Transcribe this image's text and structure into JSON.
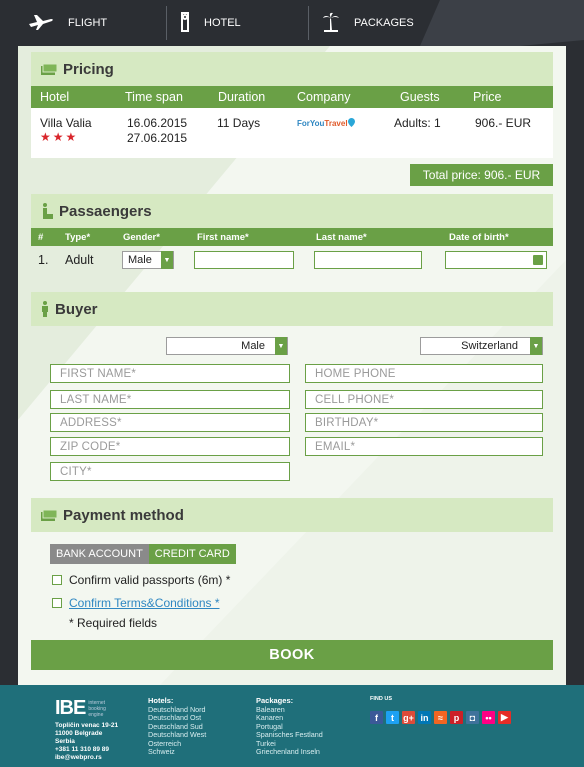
{
  "nav": {
    "flight": "FLIGHT",
    "hotel": "HOTEL",
    "packages": "PACKAGES"
  },
  "pricing": {
    "title": "Pricing",
    "headers": [
      "Hotel",
      "Time span",
      "Duration",
      "Company",
      "Guests",
      "Price"
    ],
    "row": {
      "hotel": "Villa Valia",
      "stars": "★★★",
      "date_from": "16.06.2015",
      "date_to": "27.06.2015",
      "duration": "11 Days",
      "company_a": "ForYou",
      "company_b": "Travel",
      "guests": "Adults: 1",
      "price": "906.- EUR"
    },
    "total": "Total price: 906.- EUR"
  },
  "passengers": {
    "title": "Passaengers",
    "headers": [
      "#",
      "Type*",
      "Gender*",
      "First name*",
      "Last name*",
      "Date of birth*"
    ],
    "row": {
      "num": "1.",
      "type": "Adult",
      "gender": "Male"
    }
  },
  "buyer": {
    "title": "Buyer",
    "gender": "Male",
    "country": "Switzerland",
    "fields_left": [
      "FIRST NAME*",
      "LAST NAME*",
      "ADDRESS*",
      "ZIP CODE*",
      "CITY*"
    ],
    "fields_right": [
      "HOME PHONE",
      "CELL PHONE*",
      "BIRTHDAY*",
      "EMAIL*"
    ]
  },
  "payment": {
    "title": "Payment method",
    "tab_bank": "BANK ACCOUNT",
    "tab_card": "CREDIT CARD",
    "confirm_passports": "Confirm valid passports (6m) *",
    "confirm_terms": "Confirm Terms&Conditions *",
    "required": "* Required fields",
    "book": "BOOK"
  },
  "footer": {
    "logo": "IBE",
    "logo_sub": [
      "internet",
      "booking",
      "engine"
    ],
    "address": [
      "Topličin venac 19-21",
      "11000 Belgrade",
      "Serbia",
      "+381 11 310 89 89",
      "ibe@webpro.rs"
    ],
    "hotels_title": "Hotels:",
    "hotels": [
      "Deutschland Nord",
      "Deutschland Ost",
      "Deutschland Sud",
      "Deutschland West",
      "Osterreich",
      "Schweiz"
    ],
    "packages_title": "Packages:",
    "packages": [
      "Balearen",
      "Kanaren",
      "Portugal",
      "Spanisches Festland",
      "Turkei",
      "Griechenland Inseln"
    ],
    "find_us": "FIND US",
    "social": [
      {
        "icon": "facebook-icon",
        "glyph": "f",
        "color": "#3b5998"
      },
      {
        "icon": "twitter-icon",
        "glyph": "t",
        "color": "#1da1f2"
      },
      {
        "icon": "googleplus-icon",
        "glyph": "g+",
        "color": "#dd4b39"
      },
      {
        "icon": "linkedin-icon",
        "glyph": "in",
        "color": "#0077b5"
      },
      {
        "icon": "rss-icon",
        "glyph": "≈",
        "color": "#f26522"
      },
      {
        "icon": "pinterest-icon",
        "glyph": "p",
        "color": "#cb2027"
      },
      {
        "icon": "instagram-icon",
        "glyph": "◘",
        "color": "#3f729b"
      },
      {
        "icon": "flickr-icon",
        "glyph": "••",
        "color": "#ff0084"
      },
      {
        "icon": "youtube-icon",
        "glyph": "▶",
        "color": "#e52d27"
      }
    ]
  }
}
